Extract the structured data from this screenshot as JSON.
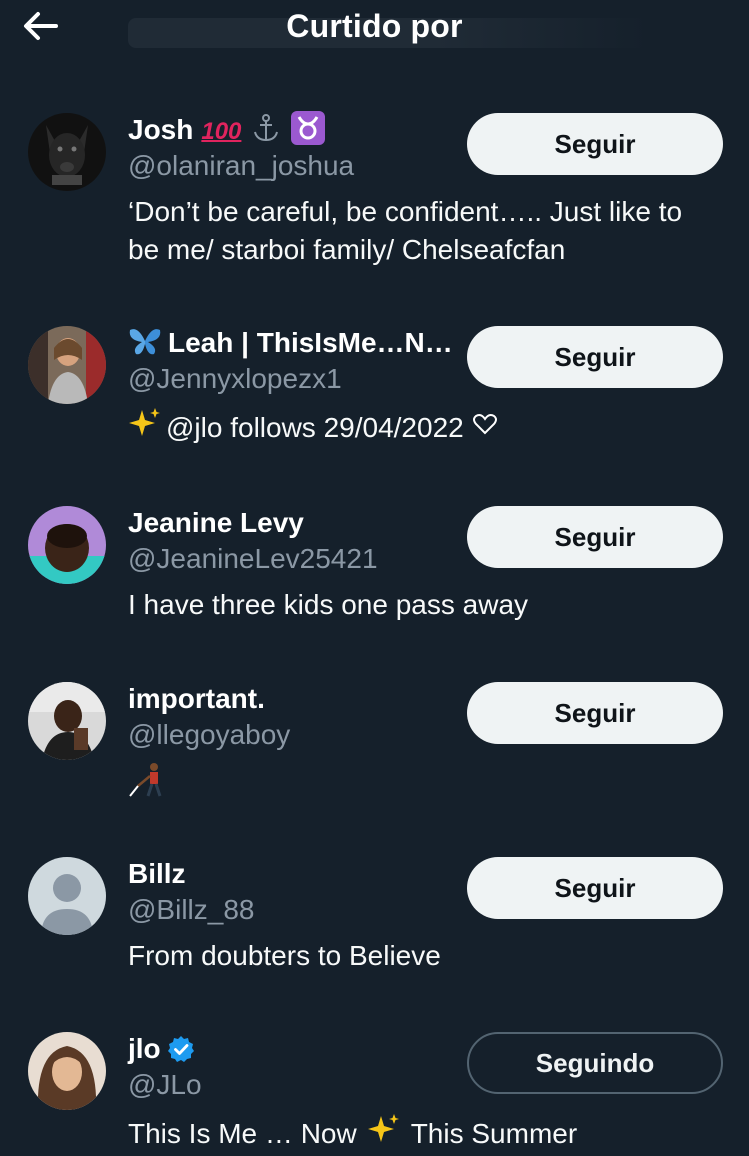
{
  "header": {
    "title": "Curtido por",
    "back_icon": "arrow-left-icon"
  },
  "users": [
    {
      "name": "Josh",
      "name_emojis": "💯⚓♉",
      "handle": "@olaniran_joshua",
      "bio_lines": [
        "‘Don’t be careful, be confident….. Just like to",
        "be me/ starboi family/ Chelseafcfan"
      ],
      "button": "Seguir",
      "verified": false
    },
    {
      "name": "Leah | ThisIsMe…N…",
      "name_prefix_emoji": "🦋",
      "handle": "@Jennyxlopezx1",
      "bio_lines": [
        "@jlo follows 29/04/2022"
      ],
      "bio_prefix_emoji": "✨",
      "bio_suffix_emoji": "🤍",
      "button": "Seguir",
      "verified": false
    },
    {
      "name": "Jeanine Levy",
      "handle": "@JeanineLev25421",
      "bio_lines": [
        "I have three kids one pass away"
      ],
      "button": "Seguir",
      "verified": false
    },
    {
      "name": "important.",
      "handle": "@llegoyaboy",
      "bio_emoji": "🧑‍🦯",
      "button": "Seguir",
      "verified": false
    },
    {
      "name": "Billz",
      "handle": "@Billz_88",
      "bio_lines": [
        "From doubters to Believe"
      ],
      "button": "Seguir",
      "verified": false
    },
    {
      "name": "jlo",
      "handle": "@JLo",
      "bio_lines": [
        "This Is Me … Now",
        "This Summer"
      ],
      "bio_mid_emoji": "✨",
      "button": "Seguindo",
      "verified": true
    }
  ],
  "colors": {
    "background": "#15202b",
    "text": "#ffffff",
    "secondary_text": "#8b98a5",
    "button_bg": "#eff3f4",
    "button_text": "#0f1419",
    "verified": "#1d9bf0"
  }
}
